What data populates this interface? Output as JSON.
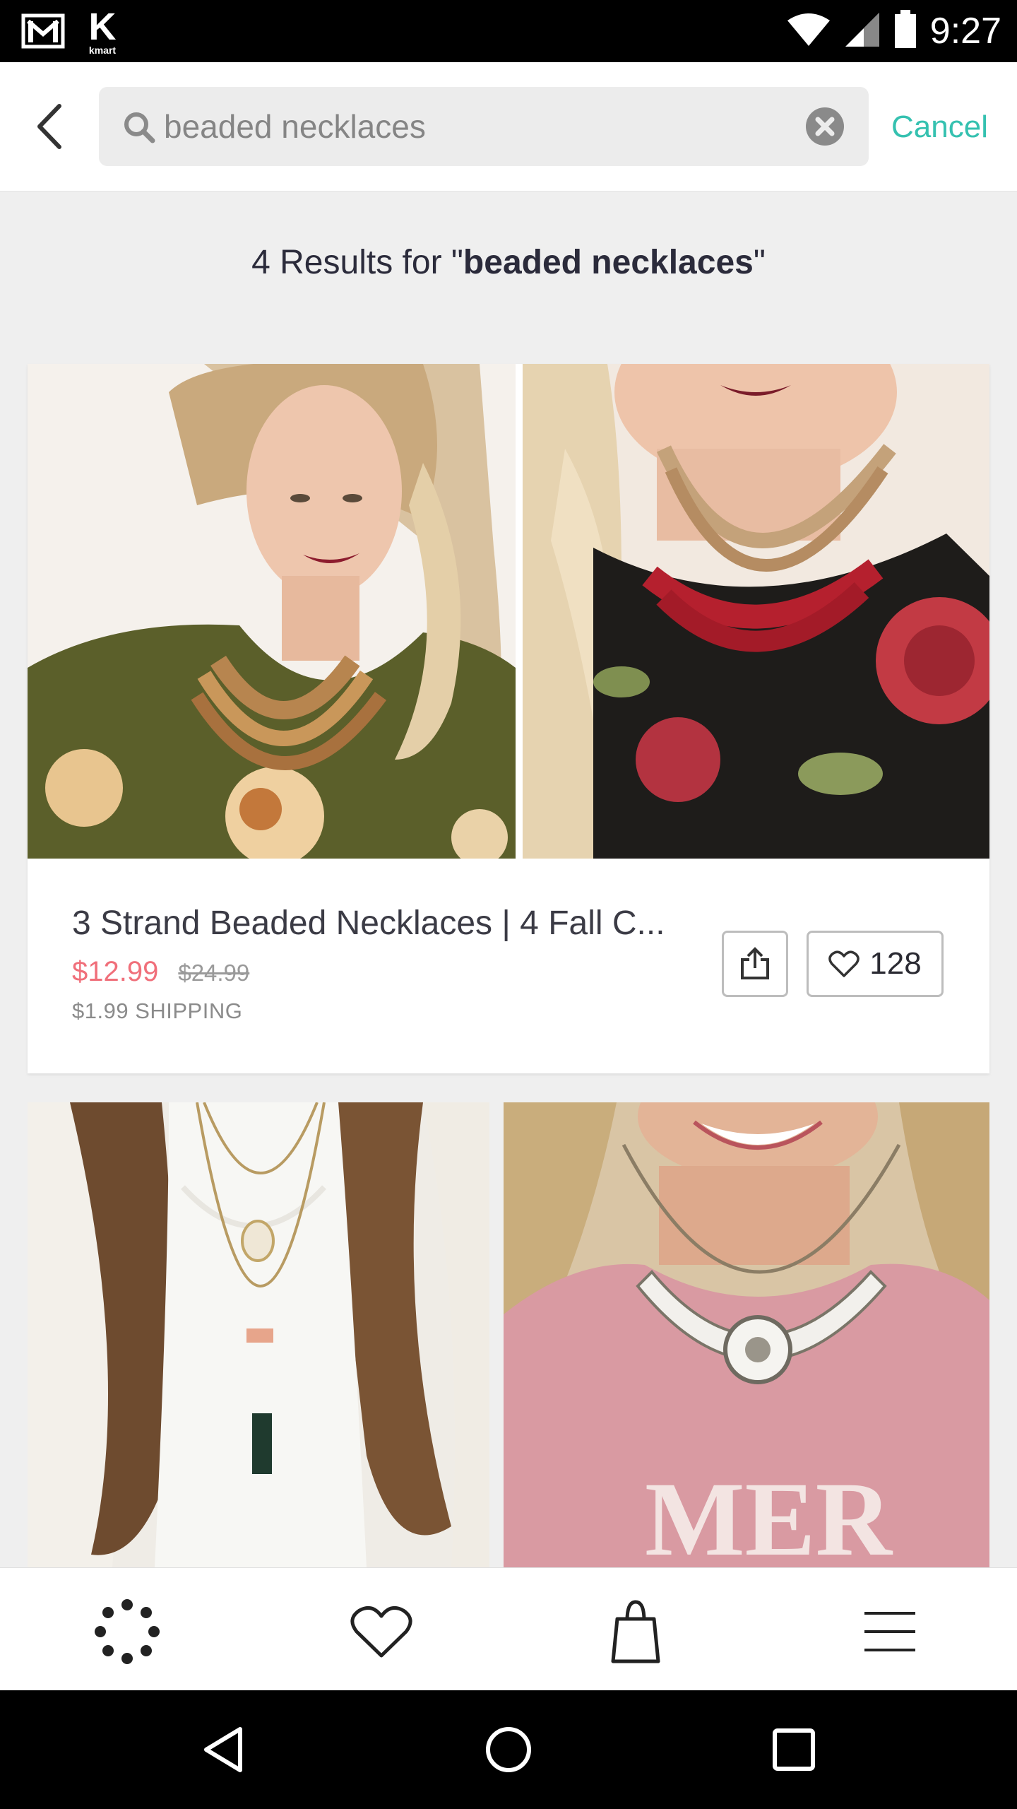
{
  "status_bar": {
    "time": "9:27",
    "app_logo_text": "kmart",
    "icons": [
      "gmail-icon",
      "kmart-icon",
      "wifi-icon",
      "cell-signal-icon",
      "battery-icon"
    ]
  },
  "search": {
    "query": "beaded necklaces",
    "placeholder": "Search",
    "cancel_label": "Cancel"
  },
  "results": {
    "prefix": "4 Results for \"",
    "query": "beaded necklaces",
    "suffix": "\""
  },
  "products": [
    {
      "title": "3 Strand Beaded Necklaces | 4 Fall C...",
      "sale_price": "$12.99",
      "original_price": "$24.99",
      "shipping": "$1.99 SHIPPING",
      "likes": "128",
      "images": [
        "woman in olive floral top with amber beaded necklace",
        "woman in black floral top with red beaded necklace"
      ]
    }
  ],
  "lower_images": [
    "woman in white top with layered pendant necklaces",
    "woman in pink tee with white statement necklace"
  ],
  "bottom_nav": [
    "discover-icon",
    "heart-icon",
    "shopping-bag-icon",
    "menu-icon"
  ],
  "system_nav": [
    "back-icon",
    "home-icon",
    "recents-icon"
  ],
  "colors": {
    "accent": "#35c1b0",
    "sale": "#f06f7a",
    "background": "#efefef"
  }
}
